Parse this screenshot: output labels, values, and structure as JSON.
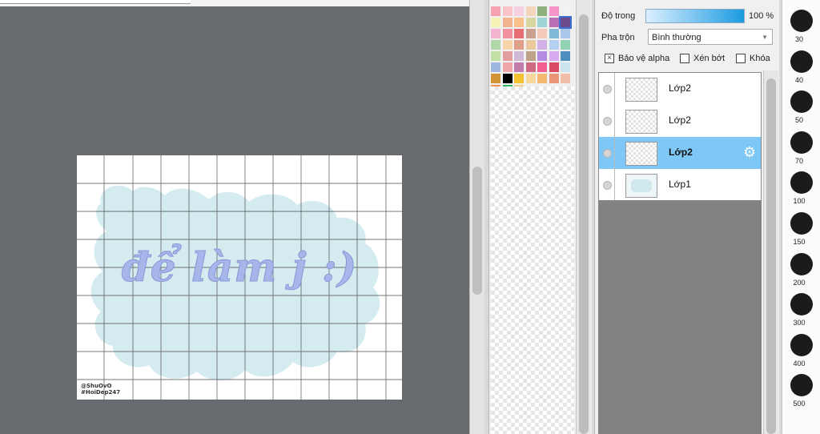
{
  "canvas": {
    "artwork_title": "để làm j :)",
    "watermark_lines": [
      "@ShuOvO",
      "#HoiDep247"
    ]
  },
  "palette": {
    "swatches": [
      "#f6a3b1",
      "#f9c4c7",
      "#f7d0e2",
      "#f3d6b9",
      "#8db07a",
      "#f594c8",
      "#f2f2f2",
      "#f6f3b6",
      "#f2b38f",
      "#f9c08a",
      "#d8d5a0",
      "#9ed6d8",
      "#b86fb4",
      "#6d4a8c",
      "#f4b3cf",
      "#f28fa1",
      "#e56f73",
      "#c8a08d",
      "#f3cbb8",
      "#7fb9d6",
      "#a9c7e8",
      "#b2d5a8",
      "#f6d4a9",
      "#de9f86",
      "#edc89d",
      "#d3b0e4",
      "#b3d0f0",
      "#92d2b5",
      "#c2dfa4",
      "#e39e9e",
      "#d1b8d6",
      "#bda286",
      "#b48be0",
      "#d6a9f0",
      "#4c8fbf",
      "#9fb6de",
      "#f0a6a8",
      "#c07ca9",
      "#ce6a80",
      "#f25e8f",
      "#d94b62",
      "#cbe4ee",
      "#d39436",
      "#000000",
      "#f3c233",
      "#f7d79b",
      "#f4b86e",
      "#e89475",
      "#f1bda8",
      "#ef8f4e",
      "#2fb36a",
      "#f7cd86"
    ]
  },
  "layer_panel": {
    "opacity_label": "Độ trong",
    "opacity_value": "100 %",
    "opacity_fraction": 1.0,
    "blend_label": "Pha trộn",
    "blend_value": "Bình thường",
    "protect_alpha_label": "Bảo vệ alpha",
    "protect_alpha_checked": true,
    "clipping_label": "Xén bớt",
    "lock_label": "Khóa",
    "layers": [
      {
        "name": "Lớp2",
        "selected": false,
        "thumb": "empty"
      },
      {
        "name": "Lớp2",
        "selected": false,
        "thumb": "empty"
      },
      {
        "name": "Lớp2",
        "selected": true,
        "thumb": "empty"
      },
      {
        "name": "Lớp1",
        "selected": false,
        "thumb": "picture"
      }
    ],
    "layer_settings_icon": "gear-icon"
  },
  "brush_sizes": [
    "30",
    "40",
    "50",
    "70",
    "100",
    "150",
    "200",
    "300",
    "400",
    "500"
  ],
  "colors": {
    "workspace_bg": "#676b6f",
    "selected_layer": "#7dc8f6",
    "cloud": "#d4ebf0",
    "title_text": "#a6b6ea"
  }
}
